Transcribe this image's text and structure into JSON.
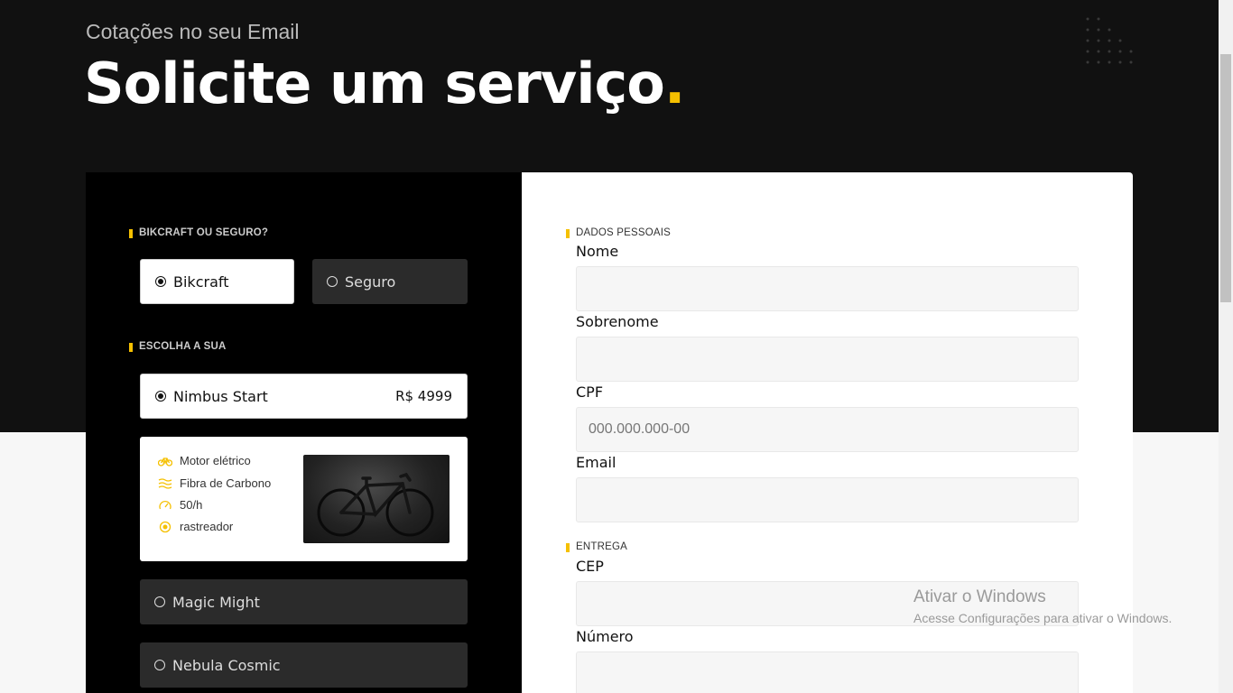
{
  "header": {
    "subtitle": "Cotações no seu Email",
    "title": "Solicite um serviço",
    "title_dot": "."
  },
  "colors": {
    "accent": "#f5c000",
    "dark_bg": "#111111",
    "panel_dark": "#000000",
    "option_dark": "#2b2b2b"
  },
  "left": {
    "section_type": "BIKCRAFT OU SEGURO?",
    "type_options": [
      {
        "label": "Bikcraft",
        "selected": true
      },
      {
        "label": "Seguro",
        "selected": false
      }
    ],
    "section_choose": "ESCOLHA A SUA",
    "bikes": [
      {
        "name": "Nimbus Start",
        "price": "R$ 4999",
        "selected": true
      },
      {
        "name": "Magic Might",
        "selected": false
      },
      {
        "name": "Nebula Cosmic",
        "selected": false
      }
    ],
    "features": [
      {
        "icon": "bike-icon",
        "text": "Motor elétrico"
      },
      {
        "icon": "layers-icon",
        "text": "Fibra de Carbono"
      },
      {
        "icon": "speedometer-icon",
        "text": "50/h"
      },
      {
        "icon": "location-icon",
        "text": "rastreador"
      }
    ]
  },
  "form": {
    "section_personal": "DADOS PESSOAIS",
    "fields": [
      {
        "label": "Nome",
        "value": "",
        "placeholder": ""
      },
      {
        "label": "Sobrenome",
        "value": "",
        "placeholder": ""
      },
      {
        "label": "CPF",
        "value": "",
        "placeholder": "000.000.000-00"
      },
      {
        "label": "Email",
        "value": "",
        "placeholder": ""
      }
    ],
    "section_delivery": "ENTREGA",
    "delivery_fields": [
      {
        "label": "CEP",
        "value": "",
        "placeholder": ""
      },
      {
        "label": "Número",
        "value": "",
        "placeholder": ""
      }
    ]
  },
  "watermark": {
    "title": "Ativar o Windows",
    "subtitle": "Acesse Configurações para ativar o Windows."
  }
}
